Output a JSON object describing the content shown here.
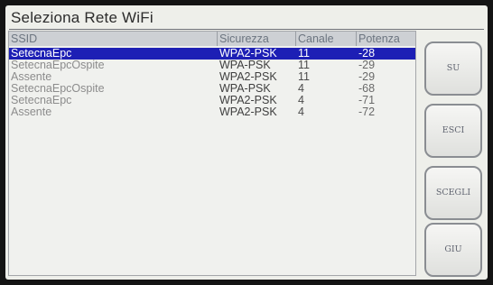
{
  "title": "Seleziona Rete WiFi",
  "table": {
    "columns": [
      "SSID",
      "Sicurezza",
      "Canale",
      "Potenza"
    ],
    "rows": [
      {
        "ssid": "SetecnaEpc",
        "security": "WPA2-PSK",
        "channel": "11",
        "power": "-28",
        "selected": true
      },
      {
        "ssid": "SetecnaEpcOspite",
        "security": "WPA-PSK",
        "channel": "11",
        "power": "-29",
        "selected": false
      },
      {
        "ssid": "Assente",
        "security": "WPA2-PSK",
        "channel": "11",
        "power": "-29",
        "selected": false
      },
      {
        "ssid": "SetecnaEpcOspite",
        "security": "WPA-PSK",
        "channel": "4",
        "power": "-68",
        "selected": false
      },
      {
        "ssid": "SetecnaEpc",
        "security": "WPA2-PSK",
        "channel": "4",
        "power": "-71",
        "selected": false
      },
      {
        "ssid": "Assente",
        "security": "WPA2-PSK",
        "channel": "4",
        "power": "-72",
        "selected": false
      }
    ]
  },
  "buttons": {
    "up": "SU",
    "exit": "ESCI",
    "select": "SCEGLI",
    "down": "GIU"
  },
  "colors": {
    "selection": "#1d1fb5",
    "header": "#cdd0d4",
    "panel": "#eeefea"
  }
}
